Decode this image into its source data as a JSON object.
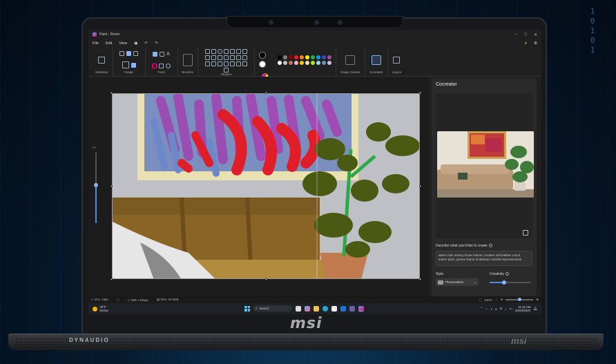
{
  "background": {
    "binary_digits": [
      "1",
      "0",
      "1",
      "0",
      "1"
    ]
  },
  "window": {
    "title": "Paint - Room"
  },
  "menu": {
    "items": [
      "File",
      "Edit",
      "View"
    ]
  },
  "ribbon": {
    "groups": [
      "Selection",
      "Image",
      "Tools",
      "Brushes",
      "Shapes",
      "Colors",
      "Image Creator",
      "Cocreator",
      "Layers"
    ]
  },
  "colors": {
    "palette": [
      "#000000",
      "#7f7f7f",
      "#880015",
      "#ed1c24",
      "#ff7f27",
      "#fff200",
      "#22b14c",
      "#00a2e8",
      "#3f48cc",
      "#a349a4",
      "#ffffff",
      "#c3c3c3",
      "#b97a57",
      "#ffaec9",
      "#ffc90e",
      "#efe4b0",
      "#b5e61d",
      "#99d9ea",
      "#7092be",
      "#c8bfe7"
    ]
  },
  "zoom_slider": {
    "label": "Fit"
  },
  "cocreator": {
    "title": "Cocreator",
    "prompt_label": "Describe what you'd like to create",
    "prompt_text": "Warm mid century home interior, modern soft leather couch, indoor plant, picture frame of abstract colorful impressionism",
    "style_label": "Style",
    "style_value": "Photorealism",
    "creativity_label": "Creativity",
    "creativity_level": 0.35
  },
  "statusbar": {
    "cursor": "314, 14px",
    "selection_size": "302 × 631px",
    "file_size": "Size: 20.4KB",
    "zoom": "100%"
  },
  "taskbar": {
    "weather_temp": "78°F",
    "weather_desc": "Sunny",
    "search_placeholder": "Search",
    "time": "11:11 AM",
    "date": "10/22/2024"
  },
  "hardware": {
    "lid_logo": "msi",
    "speaker_brand": "DYNAUDIO",
    "base_logo": "msi"
  }
}
